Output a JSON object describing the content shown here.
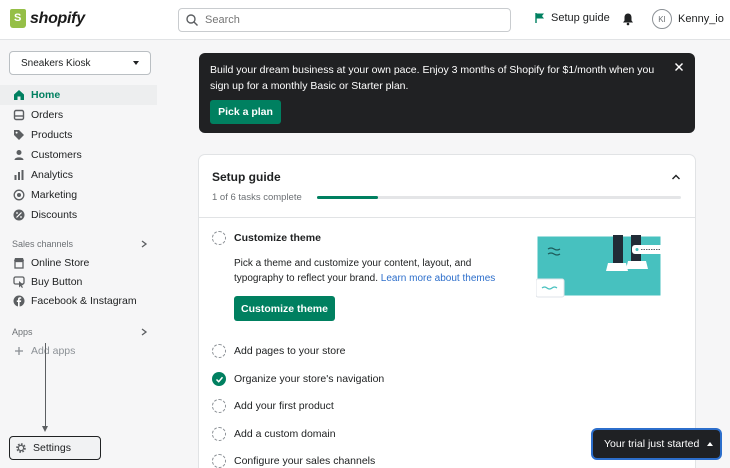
{
  "brand": {
    "name": "shopify",
    "accent": "#008060",
    "logo_color": "#95bf47"
  },
  "search": {
    "placeholder": "Search"
  },
  "header": {
    "setup_guide": "Setup guide",
    "user_initials": "KI",
    "user_name": "Kenny_io"
  },
  "sidebar": {
    "store": "Sneakers Kiosk",
    "items": [
      {
        "label": "Home",
        "icon": "home-icon",
        "active": true
      },
      {
        "label": "Orders",
        "icon": "orders-icon"
      },
      {
        "label": "Products",
        "icon": "tag-icon"
      },
      {
        "label": "Customers",
        "icon": "person-icon"
      },
      {
        "label": "Analytics",
        "icon": "bar-chart-icon"
      },
      {
        "label": "Marketing",
        "icon": "target-icon"
      },
      {
        "label": "Discounts",
        "icon": "discount-icon"
      }
    ],
    "sales_channels_label": "Sales channels",
    "channels": [
      {
        "label": "Online Store",
        "icon": "store-icon"
      },
      {
        "label": "Buy Button",
        "icon": "cursor-icon"
      },
      {
        "label": "Facebook & Instagram",
        "icon": "facebook-icon"
      }
    ],
    "apps_label": "Apps",
    "add_apps": "Add apps",
    "settings": "Settings"
  },
  "banner": {
    "text": "Build your dream business at your own pace. Enjoy 3 months of Shopify for $1/month when you sign up for a monthly Basic or Starter plan.",
    "button": "Pick a plan"
  },
  "setup": {
    "title": "Setup guide",
    "progress_text": "1 of 6 tasks complete",
    "progress_fraction": 0.167,
    "expanded_task": "Customize theme",
    "description": "Pick a theme and customize your content, layout, and typography to reflect your brand.",
    "learn_more": "Learn more about themes",
    "customize_button": "Customize theme",
    "tasks": [
      {
        "label": "Add pages to your store",
        "done": false
      },
      {
        "label": "Organize your store's navigation",
        "done": true
      },
      {
        "label": "Add your first product",
        "done": false
      },
      {
        "label": "Add a custom domain",
        "done": false
      },
      {
        "label": "Configure your sales channels",
        "done": false
      }
    ]
  },
  "trial": {
    "label": "Your trial just started"
  }
}
